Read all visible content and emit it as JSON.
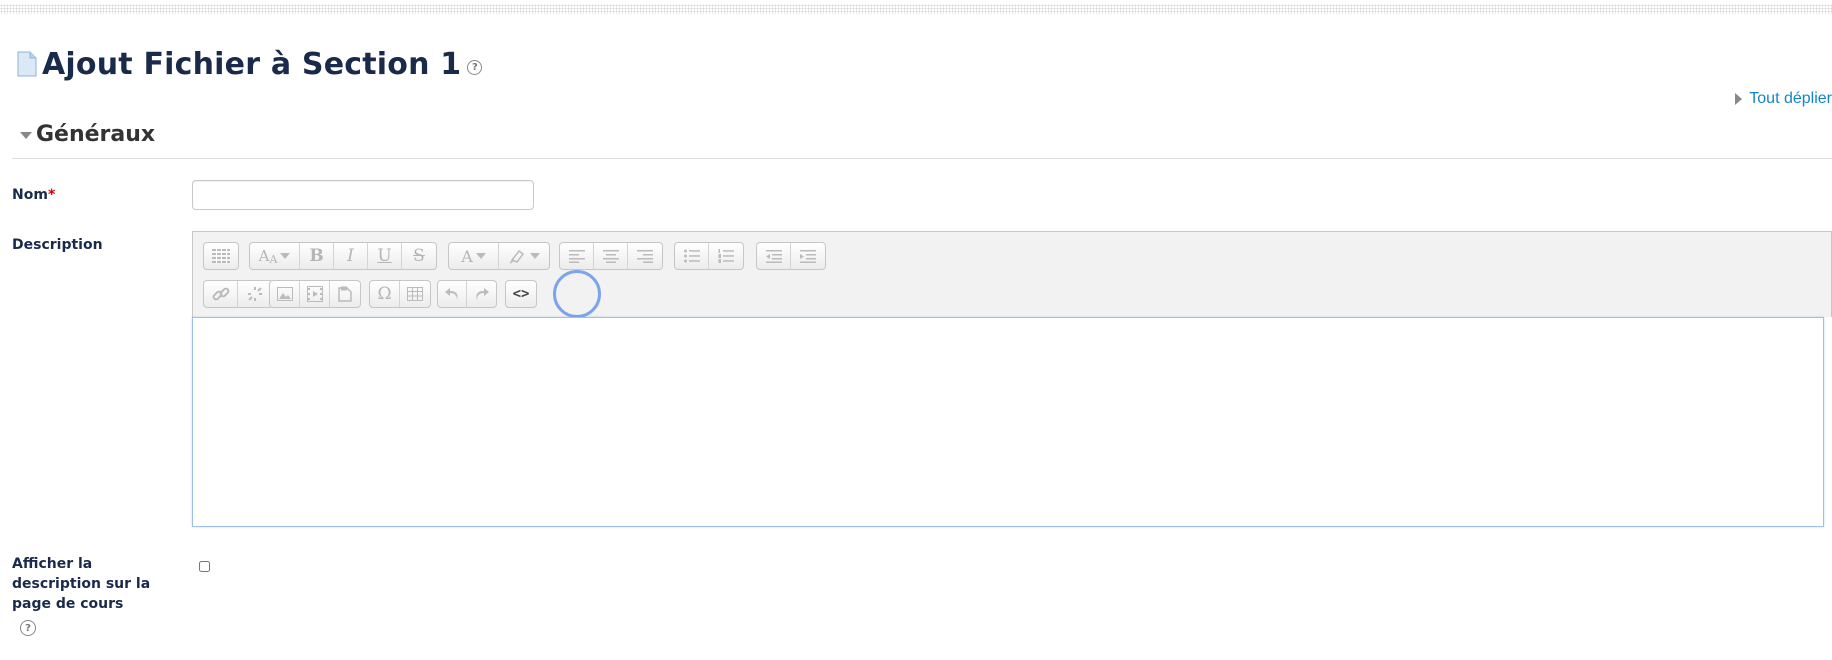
{
  "page": {
    "title": "Ajout Fichier à Section 1",
    "help_glyph": "?",
    "expand_all": "Tout déplier"
  },
  "section": {
    "title": "Généraux"
  },
  "form": {
    "name_label": "Nom",
    "required_mark": "*",
    "name_value": "",
    "description_label": "Description",
    "description_value": "",
    "show_description_label": "Afficher la description sur la page de cours",
    "show_description_checked": false,
    "help_glyph": "?"
  },
  "editor": {
    "toolbar_row1": [
      [
        "show-more-icon"
      ],
      [
        "font-style-icon",
        "bold-icon",
        "italic-icon",
        "underline-icon",
        "strikethrough-icon"
      ],
      [
        "text-color-icon",
        "background-color-icon"
      ],
      [
        "align-left-icon",
        "align-center-icon",
        "align-right-icon"
      ],
      [
        "bullet-list-icon",
        "numbered-list-icon"
      ],
      [
        "outdent-icon",
        "indent-icon"
      ]
    ],
    "toolbar_row2": [
      [
        "link-icon",
        "unlink-icon"
      ],
      [
        "image-icon",
        "media-icon",
        "manage-files-icon"
      ],
      [
        "special-char-icon",
        "table-icon"
      ],
      [
        "undo-icon",
        "redo-icon"
      ],
      [
        "html-source-icon"
      ]
    ],
    "glyphs": {
      "bold": "B",
      "italic": "I",
      "underline": "U",
      "strike": "S",
      "omega": "Ω",
      "html": "<>"
    },
    "highlighted_button": "html-source-icon"
  },
  "colors": {
    "title": "#1a2a4a",
    "link": "#1585c9",
    "required": "#cc0000",
    "focus_ring": "#7ba4ec",
    "toolbar_bg": "#f2f2f2"
  }
}
